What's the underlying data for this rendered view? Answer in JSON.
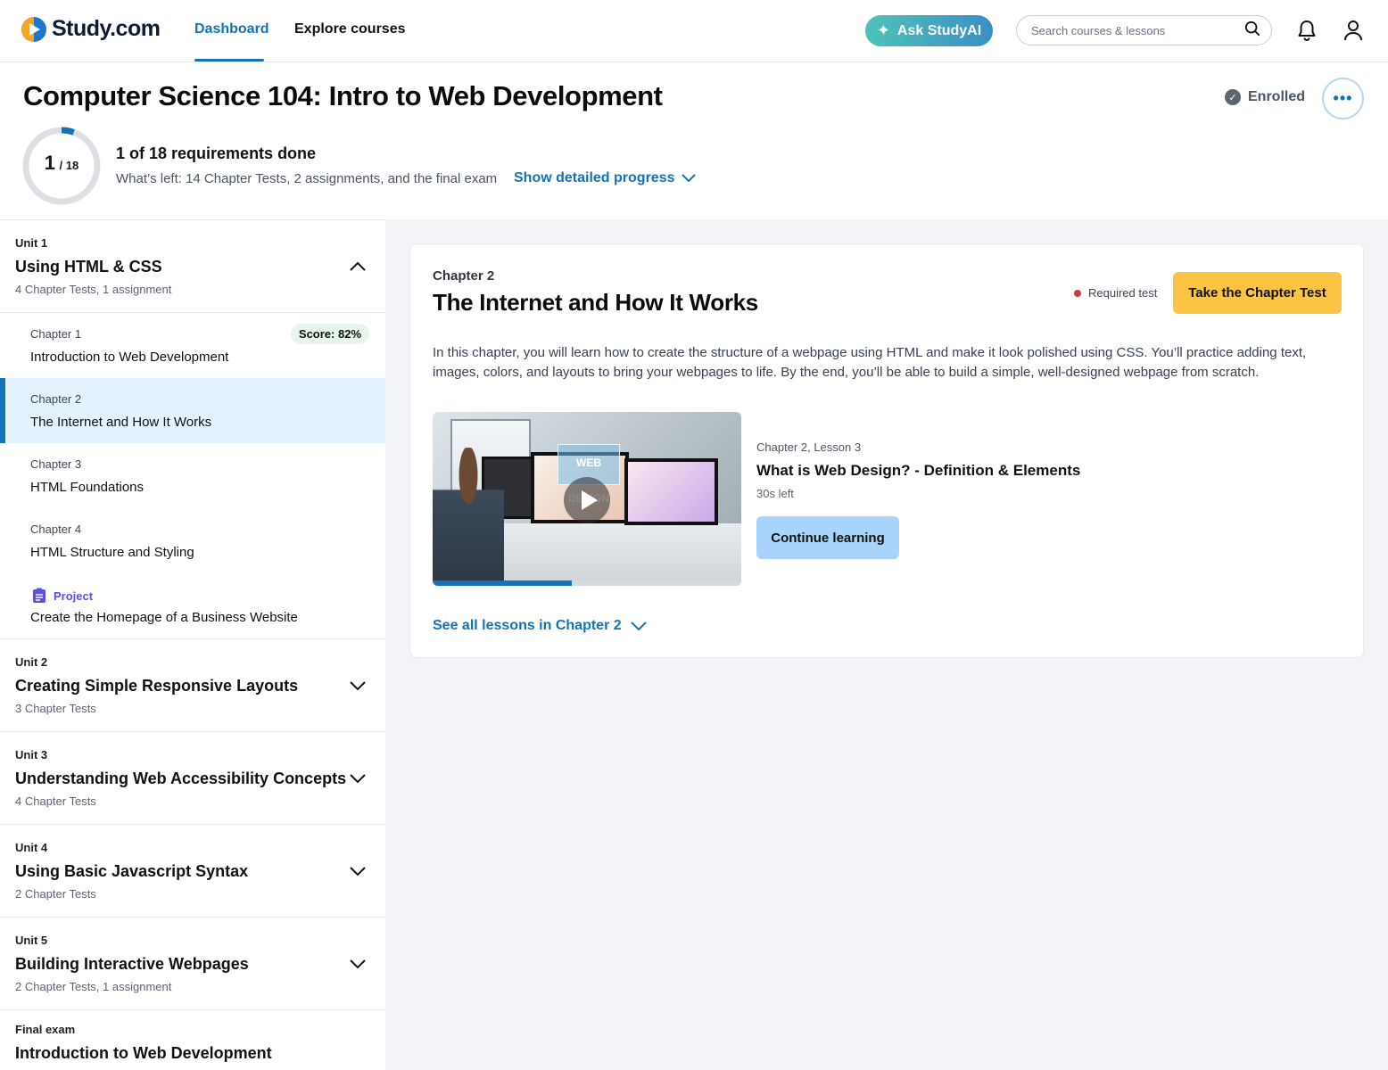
{
  "nav": {
    "logo_text": "Study.com",
    "links": [
      "Dashboard",
      "Explore courses"
    ],
    "active_link": "Dashboard",
    "ask_label": "Ask StudyAI",
    "search_placeholder": "Search courses & lessons",
    "icons": [
      "search-icon",
      "bell-icon",
      "user-icon"
    ]
  },
  "course": {
    "title": "Computer Science 104: Intro to Web Development",
    "enrolled_label": "Enrolled",
    "more_label": "•••"
  },
  "progress": {
    "done": 1,
    "total": 18,
    "done_text": "1",
    "total_text": "/ 18",
    "summary": "1 of 18 requirements done",
    "remaining": "What’s left: 14 Chapter Tests, 2 assignments, and the final exam",
    "show_detail_label": "Show detailed progress"
  },
  "sidebar": {
    "unit1": {
      "label": "Unit 1",
      "title": "Using HTML & CSS",
      "meta": "4 Chapter Tests, 1 assignment",
      "expanded": true,
      "chapters": [
        {
          "label": "Chapter 1",
          "title": "Introduction to Web Development",
          "score": "Score: 82%"
        },
        {
          "label": "Chapter 2",
          "title": "The Internet and How It Works",
          "active": true
        },
        {
          "label": "Chapter 3",
          "title": "HTML Foundations"
        },
        {
          "label": "Chapter 4",
          "title": "HTML Structure and Styling"
        }
      ],
      "project": {
        "label": "Project",
        "title": "Create the Homepage of a Business Website"
      }
    },
    "units": [
      {
        "label": "Unit 2",
        "title": "Creating Simple Responsive Layouts",
        "meta": "3 Chapter Tests"
      },
      {
        "label": "Unit 3",
        "title": "Understanding Web Accessibility Concepts",
        "meta": "4 Chapter Tests"
      },
      {
        "label": "Unit 4",
        "title": "Using Basic Javascript Syntax",
        "meta": "2 Chapter Tests"
      },
      {
        "label": "Unit 5",
        "title": "Building Interactive Webpages",
        "meta": "2 Chapter Tests, 1 assignment"
      }
    ],
    "final": {
      "label": "Final exam",
      "title": "Introduction to Web Development"
    }
  },
  "main": {
    "chapter_label": "Chapter 2",
    "chapter_title": "The Internet and How It Works",
    "required_label": "Required test",
    "take_test_label": "Take the Chapter Test",
    "description": "In this chapter, you will learn how to create the structure of a webpage using HTML and make it look polished using CSS. You’ll practice adding text, images, colors, and layouts to bring your webpages to life. By the end, you’ll be able to build a simple, well-designed webpage from scratch.",
    "lesson": {
      "label": "Chapter 2, Lesson 3",
      "title": "What is Web Design? - Definition & Elements",
      "time_left": "30s left",
      "video_progress": 0.45,
      "thumb_text": "WEB DESIGN"
    },
    "continue_label": "Continue learning",
    "see_all_label": "See all lessons in Chapter 2"
  },
  "colors": {
    "accent": "#1672b8",
    "active_bg": "#e3f2fd",
    "take_test": "#fcc443",
    "continue": "#a8d4fb",
    "required_dot": "#d9363e",
    "score_bg": "#e6f6ed",
    "project": "#5b4ff0"
  }
}
